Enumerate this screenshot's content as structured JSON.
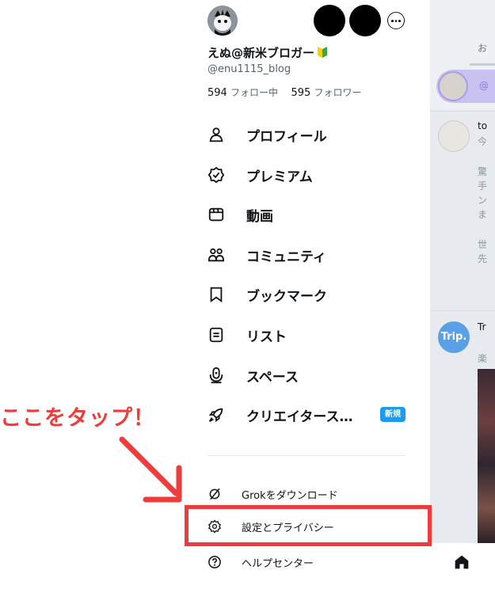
{
  "profile": {
    "display_name": "えぬ@新米ブロガー",
    "handle": "@enu1115_blog",
    "following_count": "594",
    "following_label": "フォロー中",
    "followers_count": "595",
    "followers_label": "フォロワー"
  },
  "menu": [
    {
      "label": "プロフィール",
      "icon": "person-icon"
    },
    {
      "label": "プレミアム",
      "icon": "verified-badge-icon"
    },
    {
      "label": "動画",
      "icon": "video-icon"
    },
    {
      "label": "コミュニティ",
      "icon": "communities-icon"
    },
    {
      "label": "ブックマーク",
      "icon": "bookmark-icon"
    },
    {
      "label": "リスト",
      "icon": "list-icon"
    },
    {
      "label": "スペース",
      "icon": "spaces-icon"
    },
    {
      "label": "クリエイタース…",
      "icon": "rocket-icon",
      "badge": "新規"
    }
  ],
  "bottom_menu": [
    {
      "label": "Grokをダウンロード",
      "icon": "grok-icon"
    },
    {
      "label": "設定とプライバシー",
      "icon": "gear-icon"
    },
    {
      "label": "ヘルプセンター",
      "icon": "help-icon"
    }
  ],
  "annotation": {
    "text": "ここをタップ！",
    "color": "#ee3b3b"
  },
  "background_feed": {
    "tab_partial": "お",
    "at_partial": "@",
    "lines": [
      "to",
      "今",
      "驚",
      "手",
      "ン",
      "ま",
      "世",
      "先"
    ],
    "trip_avatar": "Trip.",
    "trip_partial": "Tr",
    "trip_line2": "楽"
  },
  "colors": {
    "accent": "#1d9bf0",
    "text": "#0f1419",
    "muted": "#536471"
  }
}
